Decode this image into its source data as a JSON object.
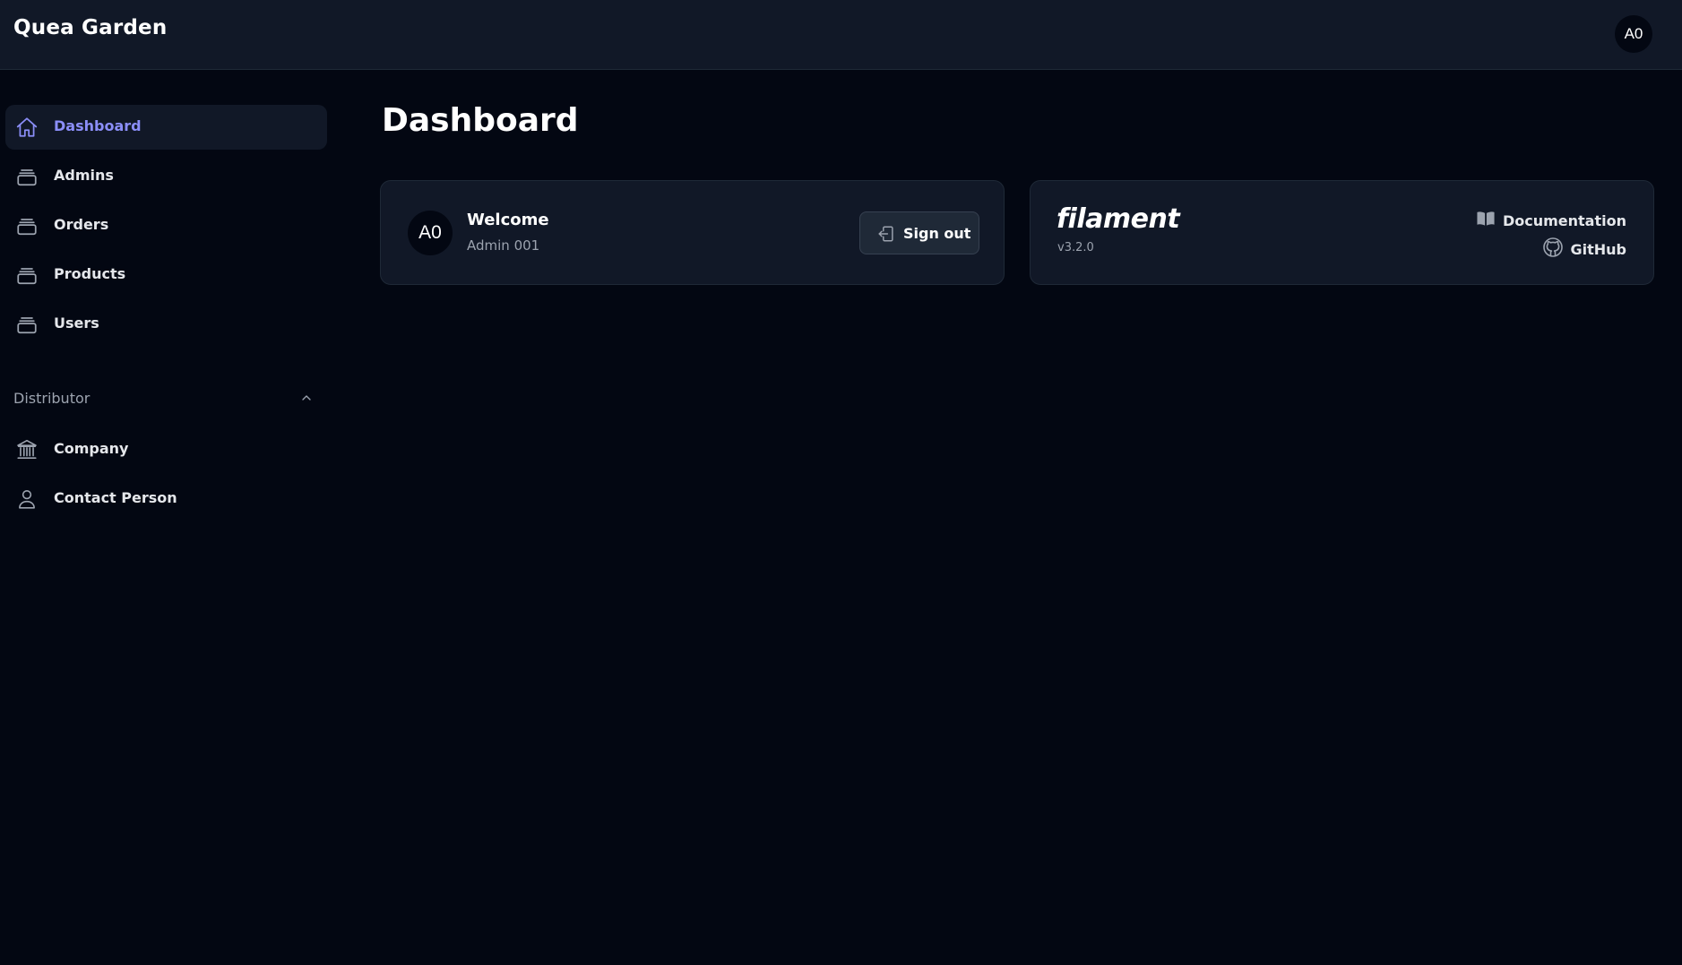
{
  "app": {
    "brand": "Quea Garden",
    "user_initials": "A0"
  },
  "sidebar": {
    "items": [
      {
        "label": "Dashboard",
        "icon": "home-icon",
        "active": true
      },
      {
        "label": "Admins",
        "icon": "rectangle-stack-icon",
        "active": false
      },
      {
        "label": "Orders",
        "icon": "rectangle-stack-icon",
        "active": false
      },
      {
        "label": "Products",
        "icon": "rectangle-stack-icon",
        "active": false
      },
      {
        "label": "Users",
        "icon": "rectangle-stack-icon",
        "active": false
      }
    ],
    "group": {
      "label": "Distributor",
      "expanded": true,
      "items": [
        {
          "label": "Company",
          "icon": "building-library-icon"
        },
        {
          "label": "Contact Person",
          "icon": "user-icon"
        }
      ]
    }
  },
  "main": {
    "title": "Dashboard",
    "welcome_card": {
      "avatar_initials": "A0",
      "title": "Welcome",
      "user_name": "Admin 001",
      "signout_label": "Sign out"
    },
    "filament_card": {
      "logo_text": "filament",
      "version": "v3.2.0",
      "documentation_label": "Documentation",
      "github_label": "GitHub"
    }
  },
  "colors": {
    "background": "#030712",
    "surface": "#111827",
    "border": "#1f2937",
    "accent": "#8b8ef8",
    "muted_text": "#9ca3af"
  }
}
